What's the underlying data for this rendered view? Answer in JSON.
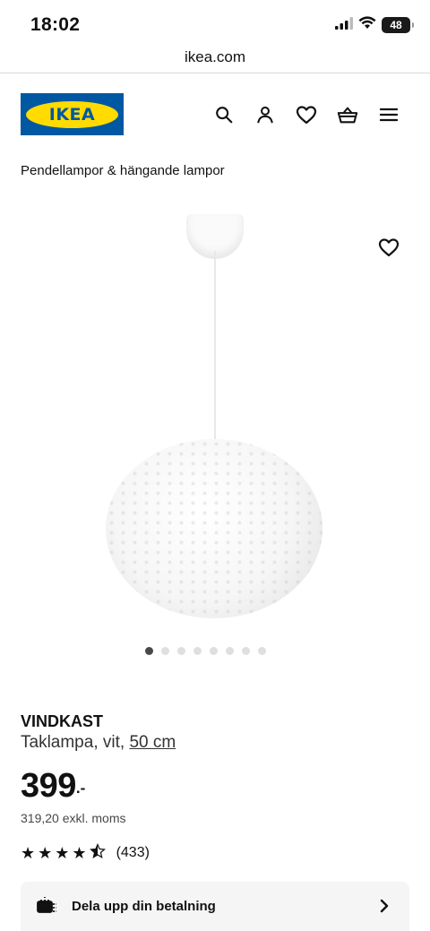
{
  "status_bar": {
    "time": "18:02",
    "battery": "48"
  },
  "browser": {
    "url": "ikea.com"
  },
  "header": {
    "logo_text": "IKEA",
    "icons": [
      "search-icon",
      "account-icon",
      "heart-icon",
      "basket-icon",
      "menu-icon"
    ]
  },
  "breadcrumb": "Pendellampor & hängande lampor",
  "gallery": {
    "slide_count": 8,
    "active_slide": 1
  },
  "product": {
    "name": "VINDKAST",
    "description": "Taklampa, vit, ",
    "size_link": "50 cm",
    "price": "399",
    "price_suffix": ".-",
    "price_excl": "319,20 exkl. moms",
    "rating_stars": 4.5,
    "rating_count": "(433)"
  },
  "payment": {
    "label": "Dela upp din betalning"
  },
  "colors": {
    "ikea_blue": "#0058a3",
    "ikea_yellow": "#ffdb00"
  }
}
